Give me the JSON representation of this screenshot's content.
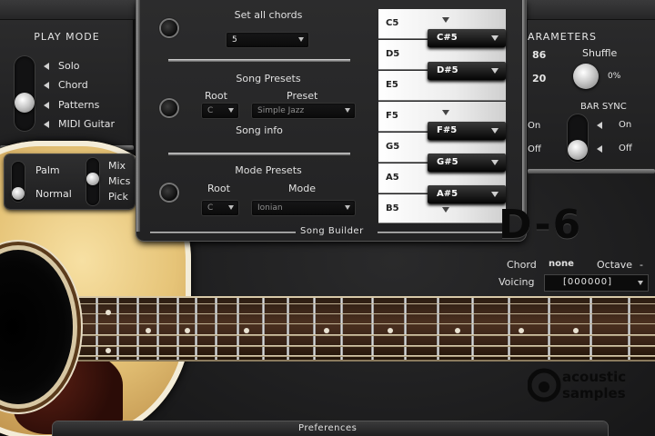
{
  "play_mode": {
    "title": "PLAY MODE",
    "options": [
      "Solo",
      "Chord",
      "Patterns",
      "MIDI Guitar"
    ]
  },
  "palm": {
    "top": "Palm",
    "bottom": "Normal",
    "mix_items": [
      "Mix",
      "Mics",
      "Pick"
    ]
  },
  "song_builder": {
    "set_all_chords": "Set all chords",
    "chord_count": "5",
    "song_presets": "Song Presets",
    "root_label": "Root",
    "preset_label": "Preset",
    "root_value": "C",
    "preset_value": "Simple Jazz",
    "song_info": "Song info",
    "mode_presets": "Mode Presets",
    "mode_root_label": "Root",
    "mode_label": "Mode",
    "mode_root_value": "C",
    "mode_value": "Ionian",
    "caption": "Song Builder"
  },
  "keyboard": {
    "white_keys": [
      "C5",
      "D5",
      "E5",
      "F5",
      "G5",
      "A5",
      "B5"
    ],
    "black_keys": [
      "C#5",
      "D#5",
      "F#5",
      "G#5",
      "A#5"
    ]
  },
  "parameters": {
    "title": "ARAMETERS",
    "value_top": "86",
    "value_bottom": "20",
    "shuffle_label": "Shuffle",
    "shuffle_value": "0%",
    "bar_sync": "BAR SYNC",
    "on_left": "On",
    "off_left": "Off",
    "on_right": "On",
    "off_right": "Off"
  },
  "instrument_name": "D-6",
  "chord_info": {
    "chord_label": "Chord",
    "chord_value": "none",
    "octave_label": "Octave",
    "octave_value": "-",
    "voicing_label": "Voicing",
    "voicing_value": "[000000]"
  },
  "logo": {
    "line1": "acoustic",
    "line2": "samples"
  },
  "preferences": "Preferences"
}
